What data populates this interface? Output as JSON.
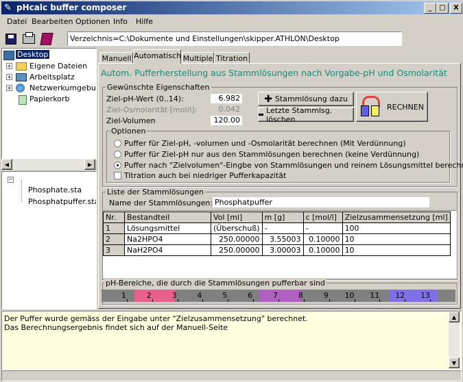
{
  "window": {
    "title": "pHcalc buffer composer",
    "controls": [
      "_",
      "□",
      "X"
    ]
  },
  "menu": [
    "Datei",
    "Bearbeiten",
    "Optionen",
    "Info",
    "Hilfe"
  ],
  "toolbar": {
    "path": "Verzeichnis=C:\\Dokumente und Einstellungen\\skipper.ATHLON\\Desktop",
    "icons": [
      "save-icon",
      "print-icon",
      "book-icon"
    ]
  },
  "tree": {
    "root": "Desktop",
    "items": [
      "Eigene Dateien",
      "Arbeitsplatz",
      "Netzwerkumgebung",
      "Papierkorb"
    ]
  },
  "files": {
    "items": [
      "Phosphate.sta",
      "Phosphatpuffer.sta"
    ]
  },
  "tabs": [
    "Manuell",
    "Automatisch",
    "Multiple",
    "Titration"
  ],
  "active_tab": "Automatisch",
  "heading": "Autom. Pufferherstellung aus Stammlösungen nach Vorgabe-pH und Osmolarität",
  "props": {
    "title": "Gewünschte Eigenschaften",
    "ph_label": "Ziel-pH-Wert (0..14):",
    "ph_value": "6.982",
    "osm_label": "Ziel-Osmolarität [mol/l]:",
    "osm_value": "0.042",
    "vol_label": "Ziel-Volumen",
    "vol_value": "120.00",
    "add_btn": "Stammlösung dazu",
    "del_btn": "Letzte Stammlsg. löschen",
    "calc_btn": "RECHNEN"
  },
  "options": {
    "title": "Optionen",
    "radios": [
      "Puffer für Ziel-pH, -volumen und -Osmolarität berechnen (Mit Verdünnung)",
      "Puffer für Ziel-pH nur aus den Stammlösungen berechnen (keine Verdünnung)",
      "Puffer nach \"Zielvolumen\"-Eingbe von Stammlösungen und reinem Lösungsmittel berechnen"
    ],
    "selected": 2,
    "checkbox": "Titration auch bei niedriger Pufferkapazität"
  },
  "stock": {
    "title": "Liste der Stammlösungen",
    "name_label": "Name der Stammlösungen:",
    "name_value": "Phosphatpuffer",
    "columns": [
      "Nr.",
      "Bestandteil",
      "Vol [ml]",
      "m [g]",
      "c [mol/l]",
      "Zielzusammensetzung [ml]"
    ],
    "rows": [
      [
        "1",
        "Lösungsmittel",
        "(Überschuß)",
        "-",
        "-",
        "100"
      ],
      [
        "2",
        "Na2HPO4",
        "250.00000",
        "3.55003",
        "0.10000",
        "10"
      ],
      [
        "3",
        "NaH2PO4",
        "250.00000",
        "3.00003",
        "0.10000",
        "10"
      ]
    ]
  },
  "ph_range": {
    "title": "pH-Bereiche, die durch die Stammlösungen pufferbar sind",
    "ticks": [
      "1",
      "2",
      "3",
      "4",
      "5",
      "6",
      "7",
      "8",
      "9",
      "10",
      "11",
      "12",
      "13"
    ],
    "bands": [
      {
        "from": 1.3,
        "to": 2.9,
        "color": "#e8608c"
      },
      {
        "from": 6.2,
        "to": 7.9,
        "color": "#b060c0"
      },
      {
        "from": 11.4,
        "to": 13.3,
        "color": "#8070e8"
      }
    ],
    "bar_color": "#808080"
  },
  "status": [
    "Der Puffer wurde gemäss der Eingabe unter \"Zielzusammensetzung\" berechnet.",
    "Das Berechnungsergebnis findet sich auf der Manuell-Seite"
  ]
}
